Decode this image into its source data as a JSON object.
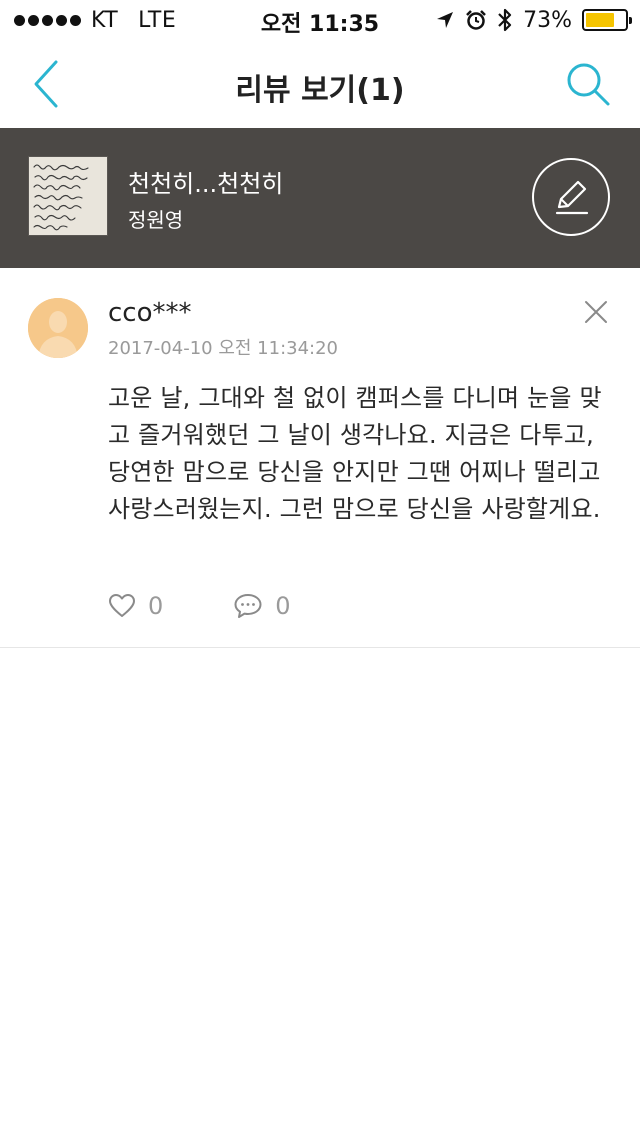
{
  "status_bar": {
    "carrier": "KT",
    "network": "LTE",
    "time": "오전 11:35",
    "battery_percent": "73%",
    "battery_level": 0.73,
    "signal_dots": 5,
    "icons": [
      "location-arrow-icon",
      "alarm-icon",
      "bluetooth-icon",
      "battery-icon"
    ]
  },
  "nav": {
    "title": "리뷰 보기(1)",
    "back_icon": "chevron-left-icon",
    "search_icon": "search-icon"
  },
  "book": {
    "title": "천천히...천천히",
    "author": "정원영",
    "write_icon": "pencil-icon"
  },
  "review": {
    "user": "cco***",
    "date": "2017-04-10 오전 11:34:20",
    "text": "고운 날, 그대와 철 없이 캠퍼스를 다니며 눈을 맞고 즐거워했던 그 날이 생각나요. 지금은 다투고, 당연한 맘으로 당신을 안지만 그땐 어찌나 떨리고 사랑스러웠는지. 그런 맘으로 당신을 사랑할게요.",
    "likes": "0",
    "comments": "0"
  },
  "colors": {
    "accent": "#2bb5d0",
    "header_bg": "#4b4845",
    "avatar_bg": "#f6c88a",
    "battery_fill": "#f5c400"
  }
}
